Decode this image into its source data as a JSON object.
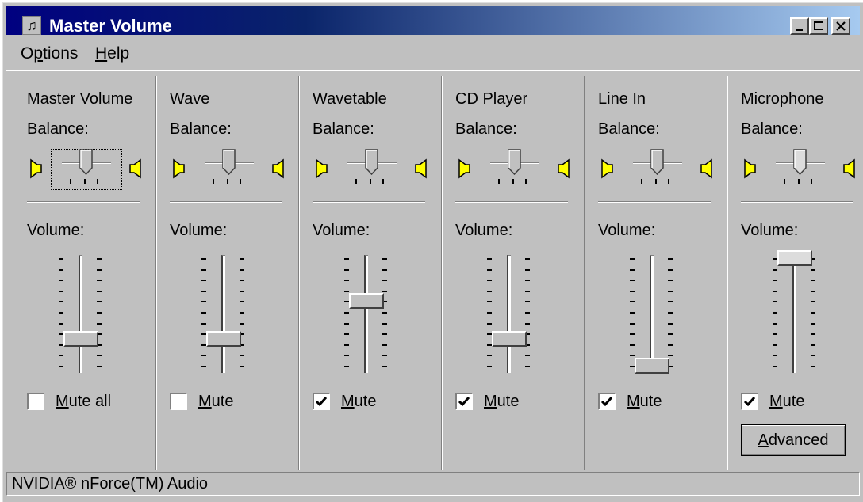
{
  "window": {
    "title": "Master Volume",
    "icon": "volume-control-app-icon",
    "controls": [
      "minimize-icon",
      "maximize-icon",
      "close-icon"
    ]
  },
  "menu": [
    {
      "label": "Options",
      "accelerator": "p"
    },
    {
      "label": "Help",
      "accelerator": "H"
    }
  ],
  "channels": [
    {
      "name": "Master Volume",
      "balance_label": "Balance:",
      "volume_label": "Volume:",
      "balance": 0.5,
      "volume": 0.25,
      "mute_label": "Mute all",
      "mute_accel": "M",
      "muted": false,
      "focused": true,
      "disabled": false
    },
    {
      "name": "Wave",
      "balance_label": "Balance:",
      "volume_label": "Volume:",
      "balance": 0.5,
      "volume": 0.25,
      "mute_label": "Mute",
      "mute_accel": "M",
      "muted": false,
      "focused": false,
      "disabled": false
    },
    {
      "name": "Wavetable",
      "balance_label": "Balance:",
      "volume_label": "Volume:",
      "balance": 0.5,
      "volume": 0.6,
      "mute_label": "Mute",
      "mute_accel": "M",
      "muted": true,
      "focused": false,
      "disabled": false
    },
    {
      "name": "CD Player",
      "balance_label": "Balance:",
      "volume_label": "Volume:",
      "balance": 0.5,
      "volume": 0.25,
      "mute_label": "Mute",
      "mute_accel": "M",
      "muted": true,
      "focused": false,
      "disabled": false
    },
    {
      "name": "Line In",
      "balance_label": "Balance:",
      "volume_label": "Volume:",
      "balance": 0.5,
      "volume": 0.0,
      "mute_label": "Mute",
      "mute_accel": "M",
      "muted": true,
      "focused": false,
      "disabled": false
    },
    {
      "name": "Microphone",
      "balance_label": "Balance:",
      "volume_label": "Volume:",
      "balance": 0.5,
      "volume": 1.0,
      "mute_label": "Mute",
      "mute_accel": "M",
      "muted": true,
      "focused": false,
      "disabled": true
    }
  ],
  "advanced_button": {
    "label": "Advanced",
    "accelerator": "A"
  },
  "status": {
    "text": "NVIDIA® nForce(TM) Audio"
  },
  "colors": {
    "title_start": "#000080",
    "title_end": "#a6caf0",
    "face": "#c0c0c0",
    "speaker": "#ffff00"
  }
}
